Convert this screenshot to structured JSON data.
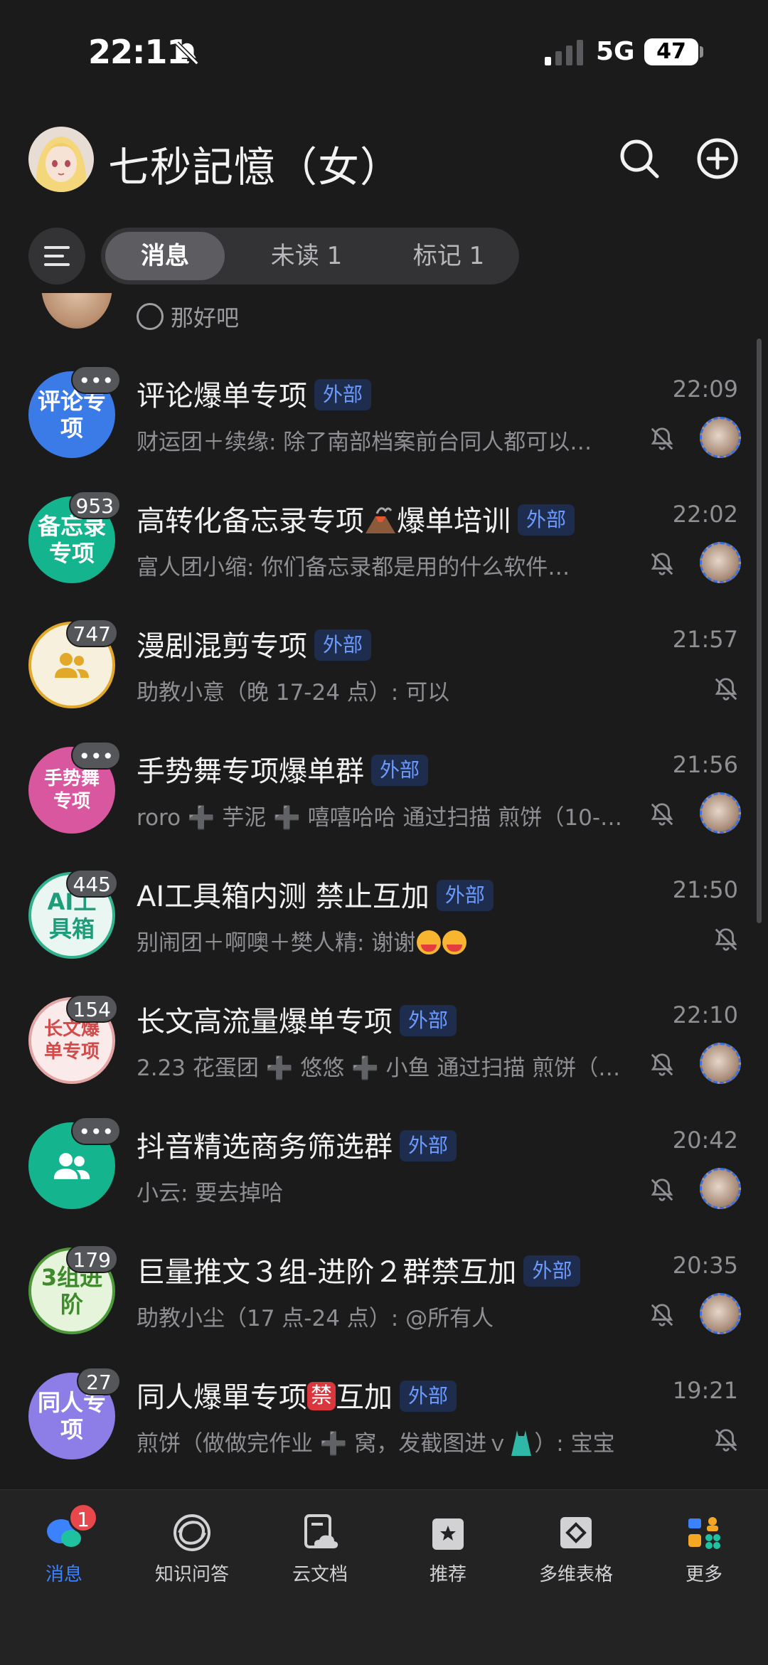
{
  "status_bar": {
    "time": "22:11",
    "network": "5G",
    "battery": "47"
  },
  "header": {
    "title": "七秒記憶（女）"
  },
  "filter_tabs": [
    {
      "label": "消息",
      "active": true
    },
    {
      "label": "未读 1",
      "active": false
    },
    {
      "label": "标记 1",
      "active": false
    }
  ],
  "partial_item": {
    "preview": "那好吧"
  },
  "external_tag": "外部",
  "chats": [
    {
      "avatar_text": "评论专项",
      "avatar_color": "#3a7be8",
      "badge": "•••",
      "name": "评论爆单专项",
      "time": "22:09",
      "preview": "财运团＋续缘: 除了南部档案前台同人都可以…",
      "muted": true,
      "mini_avatar": true
    },
    {
      "avatar_text": "备忘录专项",
      "avatar_color": "#14b48f",
      "badge": "953",
      "name": "高转化备忘录专项",
      "name_suffix": "爆单培训",
      "time": "22:02",
      "preview": "富人团小缩: 你们备忘录都是用的什么软件…",
      "muted": true,
      "mini_avatar": true
    },
    {
      "avatar_text": "",
      "avatar_color": "#f6f0dc",
      "badge": "747",
      "name": "漫剧混剪专项",
      "time": "21:57",
      "preview": "助教小意（晚 17-24 点）: 可以",
      "muted": true,
      "mini_avatar": false
    },
    {
      "avatar_text": "手势舞专项",
      "avatar_color": "#d9579f",
      "badge": "•••",
      "name": "手势舞专项爆单群",
      "time": "21:56",
      "preview": "roro ➕ 芋泥 ➕ 嘻嘻哈哈 通过扫描 煎饼（10-…",
      "muted": true,
      "mini_avatar": true
    },
    {
      "avatar_text": "AI工具箱",
      "avatar_color": "#eaf6f1",
      "badge": "445",
      "name": "AI工具箱内测 禁止互加",
      "time": "21:50",
      "preview": "别闹团＋啊噢＋樊人精: 谢谢",
      "muted": true,
      "mini_avatar": false
    },
    {
      "avatar_text": "长文爆单专项",
      "avatar_color": "#fbeaea",
      "badge": "154",
      "name": "长文高流量爆单专项",
      "time": "22:10",
      "preview": "2.23 花蛋团 ➕ 悠悠 ➕ 小鱼 通过扫描 煎饼（…",
      "muted": true,
      "mini_avatar": true
    },
    {
      "avatar_text": "",
      "avatar_color": "#14b48f",
      "badge": "•••",
      "name": "抖音精选商务筛选群",
      "time": "20:42",
      "preview": "小云: 要去掉哈",
      "muted": true,
      "mini_avatar": true
    },
    {
      "avatar_text": "3组进阶",
      "avatar_color": "#e6f4dc",
      "badge": "179",
      "name": "巨量推文３组-进阶２群禁互加",
      "time": "20:35",
      "preview": "助教小尘（17 点-24 点）: @所有人",
      "muted": true,
      "mini_avatar": true
    },
    {
      "avatar_text": "同人专项",
      "avatar_color": "#8c7ee6",
      "badge": "27",
      "name": "同人爆單专项",
      "name_chip": "禁",
      "name_suffix": "互加",
      "time": "19:21",
      "preview": "煎饼（做做完作业 ➕ 窝，发截图进ｖ",
      "preview_suffix": "）: 宝宝",
      "muted": true,
      "mini_avatar": false
    }
  ],
  "tab_bar": [
    {
      "label": "消息",
      "icon": "chat-bubbles-icon",
      "active": true,
      "badge": "1"
    },
    {
      "label": "知识问答",
      "icon": "knowledge-swirl-icon",
      "active": false
    },
    {
      "label": "云文档",
      "icon": "cloud-doc-icon",
      "active": false
    },
    {
      "label": "推荐",
      "icon": "recommend-star-icon",
      "active": false
    },
    {
      "label": "多维表格",
      "icon": "multi-table-icon",
      "active": false
    },
    {
      "label": "更多",
      "icon": "more-apps-icon",
      "active": false
    }
  ],
  "colors": {
    "accent": "#3c82ff",
    "external_tag_bg": "#1e2d4d",
    "external_tag_text": "#6c9bff",
    "badge_red": "#e8474c"
  }
}
